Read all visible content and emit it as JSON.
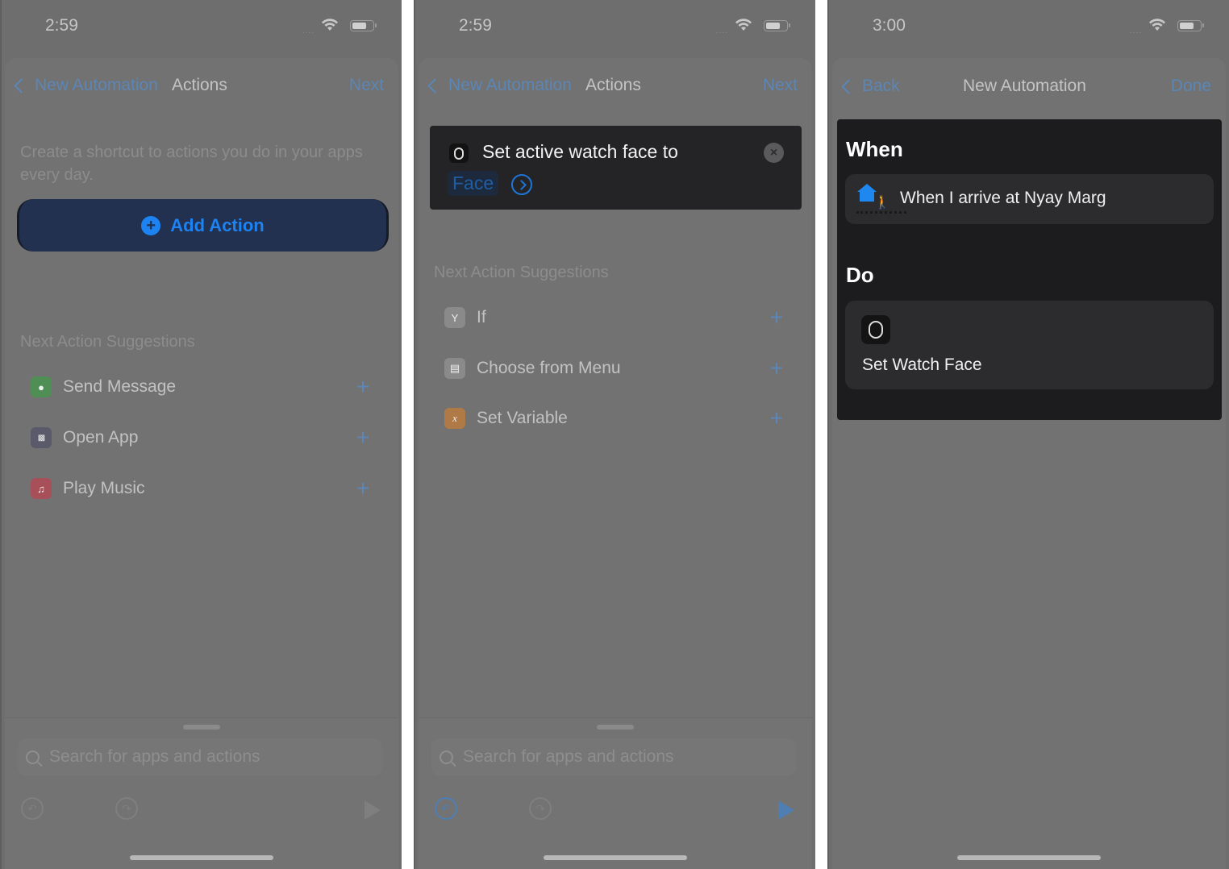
{
  "panels": [
    {
      "status": {
        "time": "2:59",
        "signal": "...."
      },
      "nav": {
        "back_label": "New Automation",
        "title": "Actions",
        "right_label": "Next"
      },
      "intro": "Create a shortcut to actions you do in your apps every day.",
      "add_action_label": "Add Action",
      "suggestions_heading": "Next Action Suggestions",
      "suggestions": [
        {
          "label": "Send Message",
          "icon": "messages-icon",
          "color": "#4f8f55"
        },
        {
          "label": "Open App",
          "icon": "app-grid-icon",
          "color": "#5a5a6a"
        },
        {
          "label": "Play Music",
          "icon": "music-note-icon",
          "color": "#a8505a"
        }
      ],
      "search_placeholder": "Search for apps and actions"
    },
    {
      "status": {
        "time": "2:59",
        "signal": "...."
      },
      "nav": {
        "back_label": "New Automation",
        "title": "Actions",
        "right_label": "Next"
      },
      "action_card": {
        "title": "Set active watch face to",
        "parameter": "Face"
      },
      "suggestions_heading": "Next Action Suggestions",
      "suggestions": [
        {
          "label": "If",
          "icon": "branch-icon",
          "color": "#8a8a8a"
        },
        {
          "label": "Choose from Menu",
          "icon": "menu-list-icon",
          "color": "#8a8a8a"
        },
        {
          "label": "Set Variable",
          "icon": "variable-x-icon",
          "color": "#b07a46"
        }
      ],
      "search_placeholder": "Search for apps and actions"
    },
    {
      "status": {
        "time": "3:00",
        "signal": "...."
      },
      "nav": {
        "back_label": "Back",
        "title": "New Automation",
        "right_label": "Done"
      },
      "when_heading": "When",
      "trigger": "When I arrive at Nyay Marg",
      "do_heading": "Do",
      "action": "Set Watch Face"
    }
  ],
  "colors": {
    "accent": "#1d82f2",
    "dimmed_link": "#5b86b6",
    "card_bg": "#1c1c1e"
  }
}
